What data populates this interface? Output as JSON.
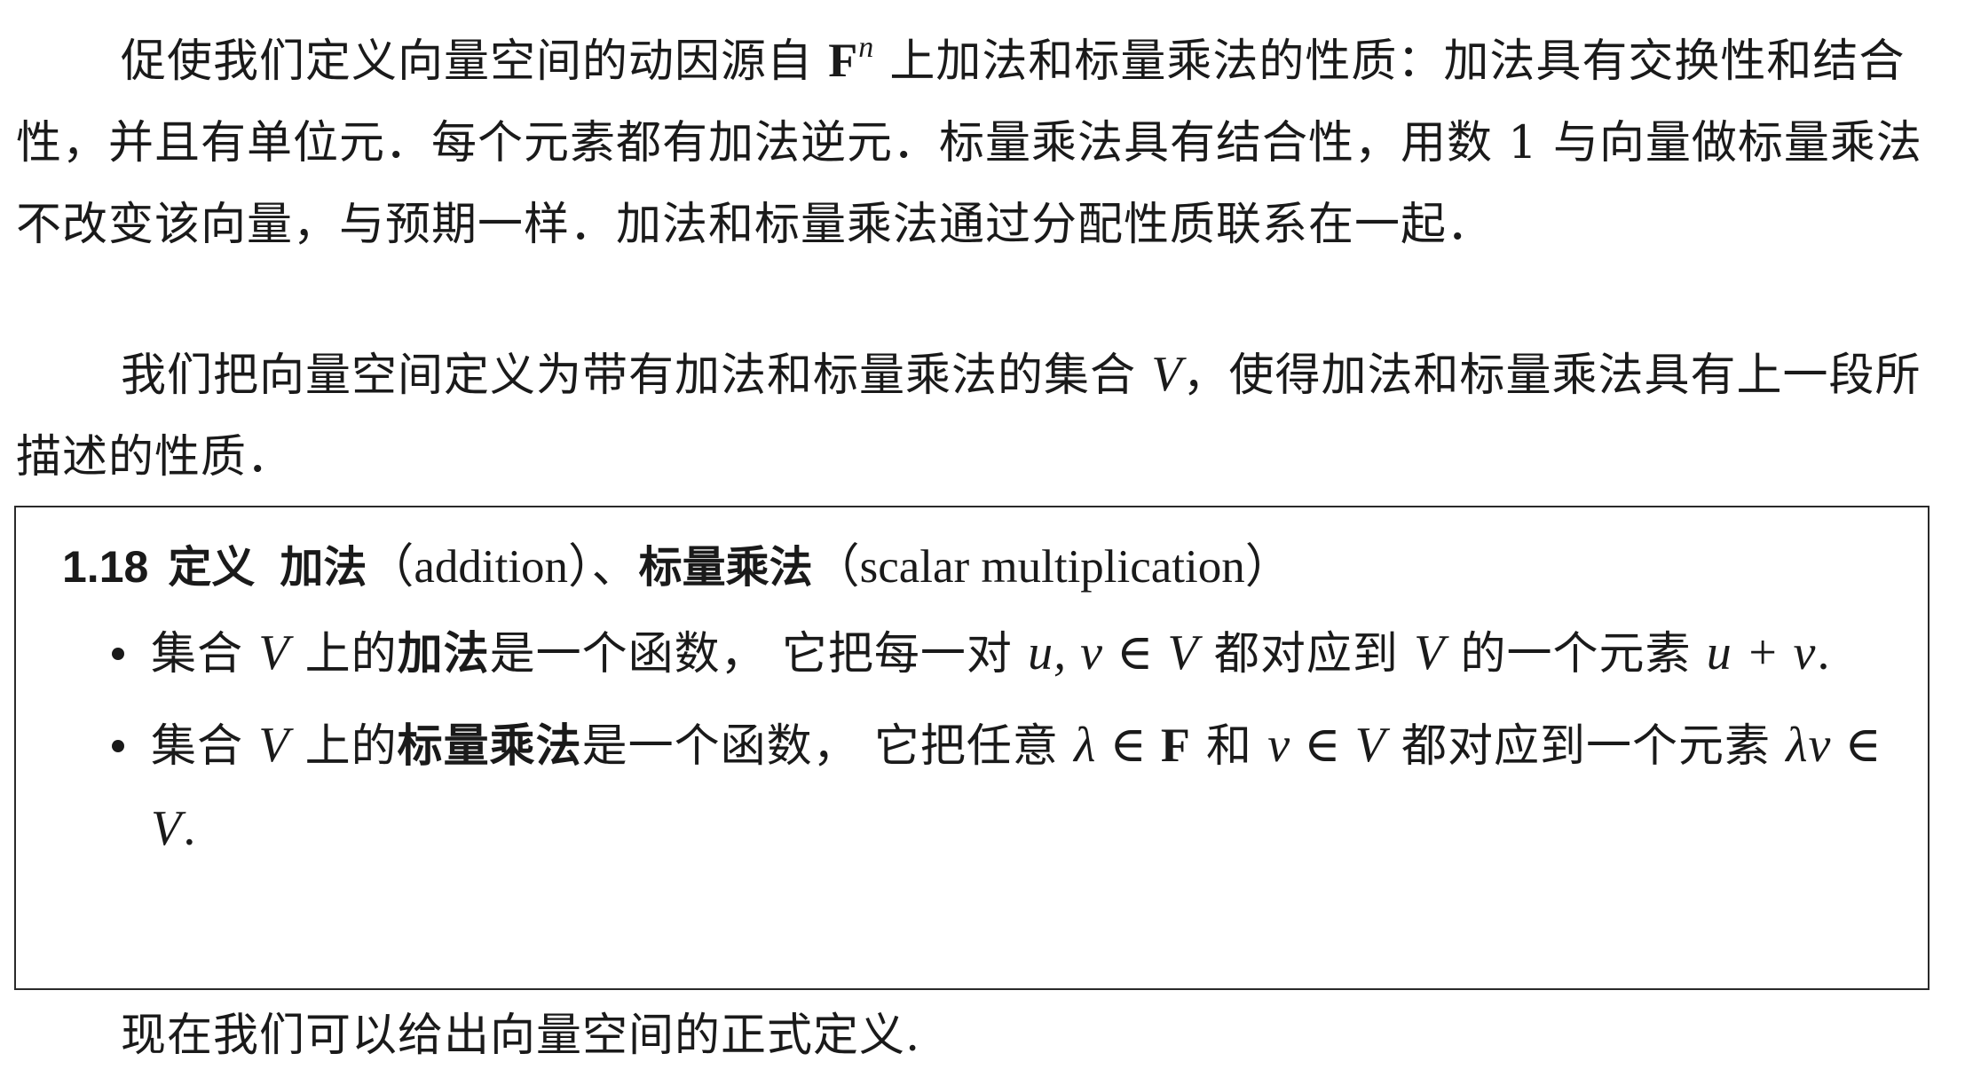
{
  "paragraph1": {
    "text_a": "促使我们定义向量空间的动因源自 ",
    "symbol_F": "F",
    "sup_n": "n",
    "text_b": " 上加法和标量乘法的性质：加法具有交换性和结合性，并且有单位元．每个元素都有加法逆元．标量乘法具有结合性，用数 1 与向量做标量乘法不改变该向量，与预期一样．加法和标量乘法通过分配性质联系在一起．"
  },
  "paragraph2": {
    "text_a": "我们把向量空间定义为带有加法和标量乘法的集合 ",
    "symbol_V": "V",
    "text_b": "，使得加法和标量乘法具有上一段所描述的性质．"
  },
  "definition": {
    "number": "1.18",
    "word": "定义",
    "term1": "加法",
    "term1_latin": "（addition）、",
    "term2": "标量乘法",
    "term2_latin": "（scalar multiplication）",
    "bullet1": {
      "text_a": "集合 ",
      "V1": "V",
      "text_b": " 上的",
      "bold": "加法",
      "text_c": "是一个函数， 它把每一对 ",
      "math_uv": "u, v ∈ V",
      "text_d": " 都对应到 ",
      "V2": "V",
      "text_e": " 的一个元素 ",
      "math_sum": "u + v",
      "text_f": "."
    },
    "bullet2": {
      "text_a": "集合 ",
      "V1": "V",
      "text_b": " 上的",
      "bold": "标量乘法",
      "text_c": "是一个函数， 它把任意 ",
      "math_lambda": "λ ∈ ",
      "field_F": "F",
      "text_d": " 和 ",
      "math_v": "v ∈ V",
      "text_e": " 都对应到一个元素 ",
      "math_prod": "λv ∈ V",
      "text_f": "."
    }
  },
  "paragraph3": {
    "text": "现在我们可以给出向量空间的正式定义."
  }
}
